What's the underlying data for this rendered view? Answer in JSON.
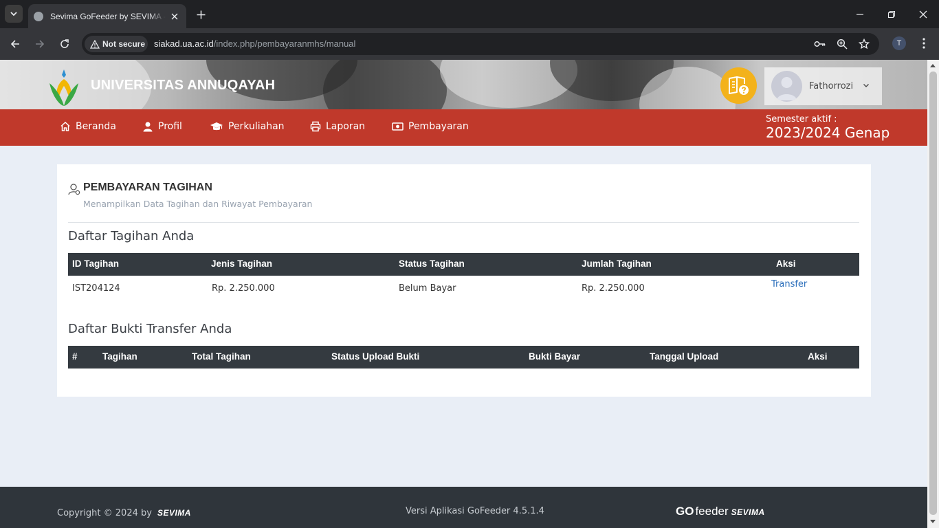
{
  "browser": {
    "tab_title": "Sevima GoFeeder by SEVIMA - Pembayaran",
    "security_label": "Not secure",
    "url_host": "siakad.ua.ac.id",
    "url_path": "/index.php/pembayaranmhs/manual",
    "profile_initial": "T"
  },
  "header": {
    "university_name": "UNIVERSITAS ANNUQAYAH",
    "user_name": "Fathorrozi"
  },
  "nav": {
    "items": [
      {
        "label": "Beranda",
        "icon": "home-icon"
      },
      {
        "label": "Profil",
        "icon": "user-icon"
      },
      {
        "label": "Perkuliahan",
        "icon": "graduation-cap-icon"
      },
      {
        "label": "Laporan",
        "icon": "printer-icon"
      },
      {
        "label": "Pembayaran",
        "icon": "money-icon"
      }
    ],
    "semester_label": "Semester aktif :",
    "semester_value": "2023/2024 Genap"
  },
  "page": {
    "title": "PEMBAYARAN TAGIHAN",
    "subtitle": "Menampilkan Data Tagihan dan Riwayat Pembayaran"
  },
  "tagihan": {
    "section_title": "Daftar Tagihan Anda",
    "columns": [
      "ID Tagihan",
      "Jenis Tagihan",
      "Status Tagihan",
      "Jumlah Tagihan",
      "Aksi"
    ],
    "rows": [
      {
        "id": "IST204124",
        "jenis": "Rp. 2.250.000",
        "status": "Belum Bayar",
        "jumlah": "Rp. 2.250.000",
        "aksi": "Transfer"
      }
    ]
  },
  "bukti": {
    "section_title": "Daftar Bukti Transfer Anda",
    "columns": [
      "#",
      "Tagihan",
      "Total Tagihan",
      "Status Upload Bukti",
      "Bukti Bayar",
      "Tanggal Upload",
      "Aksi"
    ]
  },
  "footer": {
    "copyright": "Copyright © 2024 by",
    "copyright_brand": "SEVIMA",
    "version": "Versi Aplikasi GoFeeder 4.5.1.4",
    "logo_go": "GO",
    "logo_feeder": "feeder",
    "logo_sevima": "SEVIMA"
  },
  "colors": {
    "navbar": "#c0392b",
    "table_header": "#343a40",
    "footer": "#2f353b",
    "help_button": "#f3b21b",
    "link": "#2a6ebb"
  }
}
